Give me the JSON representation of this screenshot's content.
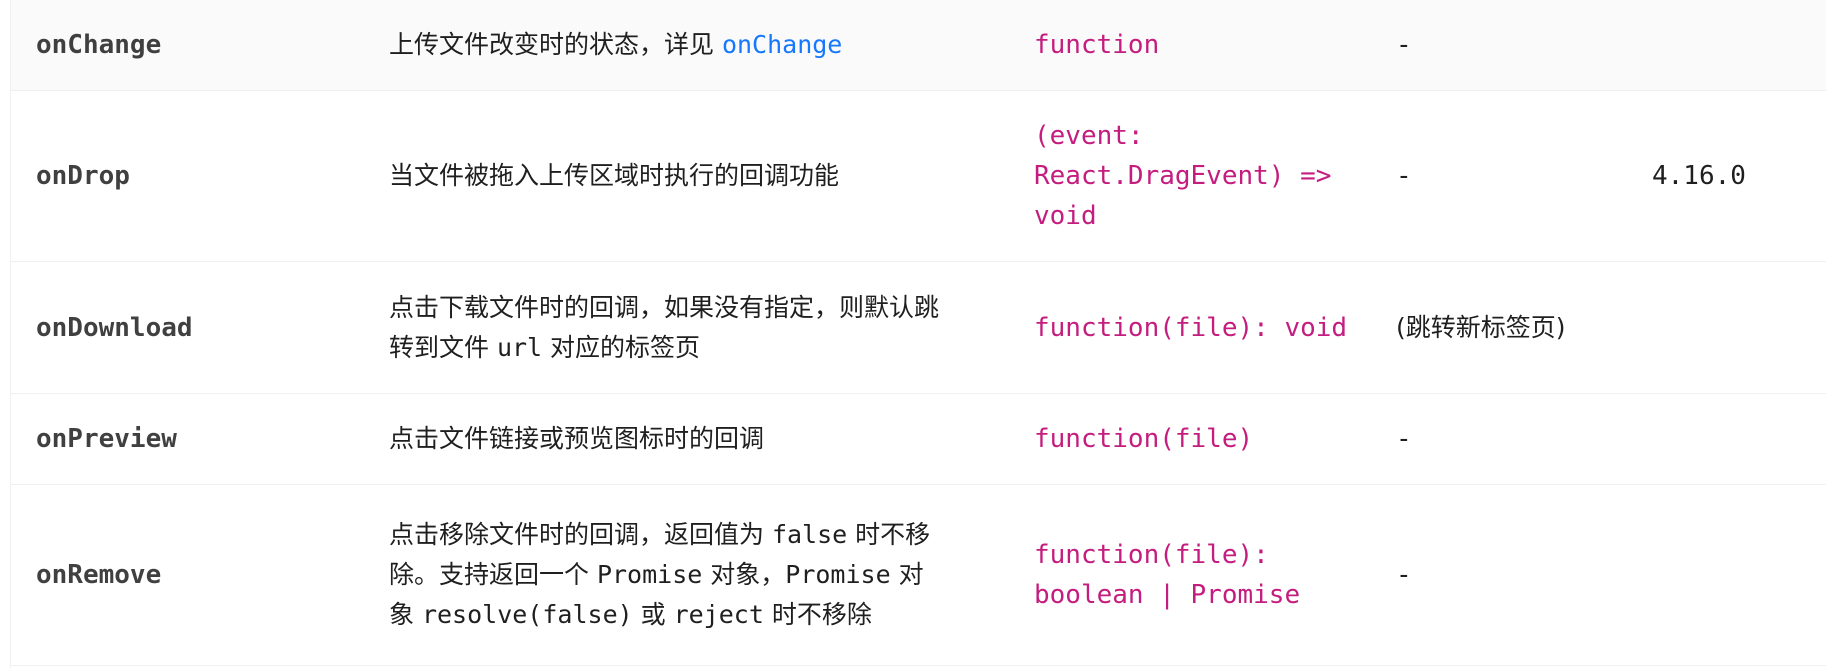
{
  "rows": [
    {
      "property": "onChange",
      "desc_text": "上传文件改变时的状态，详见 ",
      "desc_link": "onChange",
      "type": "function",
      "default": "-",
      "version": ""
    },
    {
      "property": "onDrop",
      "desc_text": "当文件被拖入上传区域时执行的回调功能",
      "type_lines": [
        "(event:",
        "React.DragEvent) =>",
        "void"
      ],
      "default": "-",
      "version": "4.16.0"
    },
    {
      "property": "onDownload",
      "desc_line1": "点击下载文件时的回调，如果没有指定，则默认跳",
      "desc_line2_pre": "转到文件 ",
      "desc_line2_code": "url",
      "desc_line2_post": " 对应的标签页",
      "type": "function(file): void",
      "default": "(跳转新标签页)",
      "version": ""
    },
    {
      "property": "onPreview",
      "desc_text": "点击文件链接或预览图标时的回调",
      "type": "function(file)",
      "default": "-",
      "version": ""
    },
    {
      "property": "onRemove",
      "desc_l1_pre": "点击移除文件时的回调，返回值为 ",
      "desc_l1_code": "false",
      "desc_l1_post": " 时不移",
      "desc_l2_pre": "除。支持返回一个 ",
      "desc_l2_code1": "Promise",
      "desc_l2_mid": " 对象，",
      "desc_l2_code2": "Promise",
      "desc_l2_post": " 对",
      "desc_l3_pre": "象 ",
      "desc_l3_code1": "resolve(false)",
      "desc_l3_mid": " 或 ",
      "desc_l3_code2": "reject",
      "desc_l3_post": " 时不移除",
      "type_lines": [
        "function(file):",
        "boolean | Promise"
      ],
      "default": "-",
      "version": ""
    }
  ],
  "colors": {
    "link": "#1677ff",
    "type": "#c41d7f",
    "row_shade": "#fafafa",
    "border": "#f0f0f0"
  }
}
